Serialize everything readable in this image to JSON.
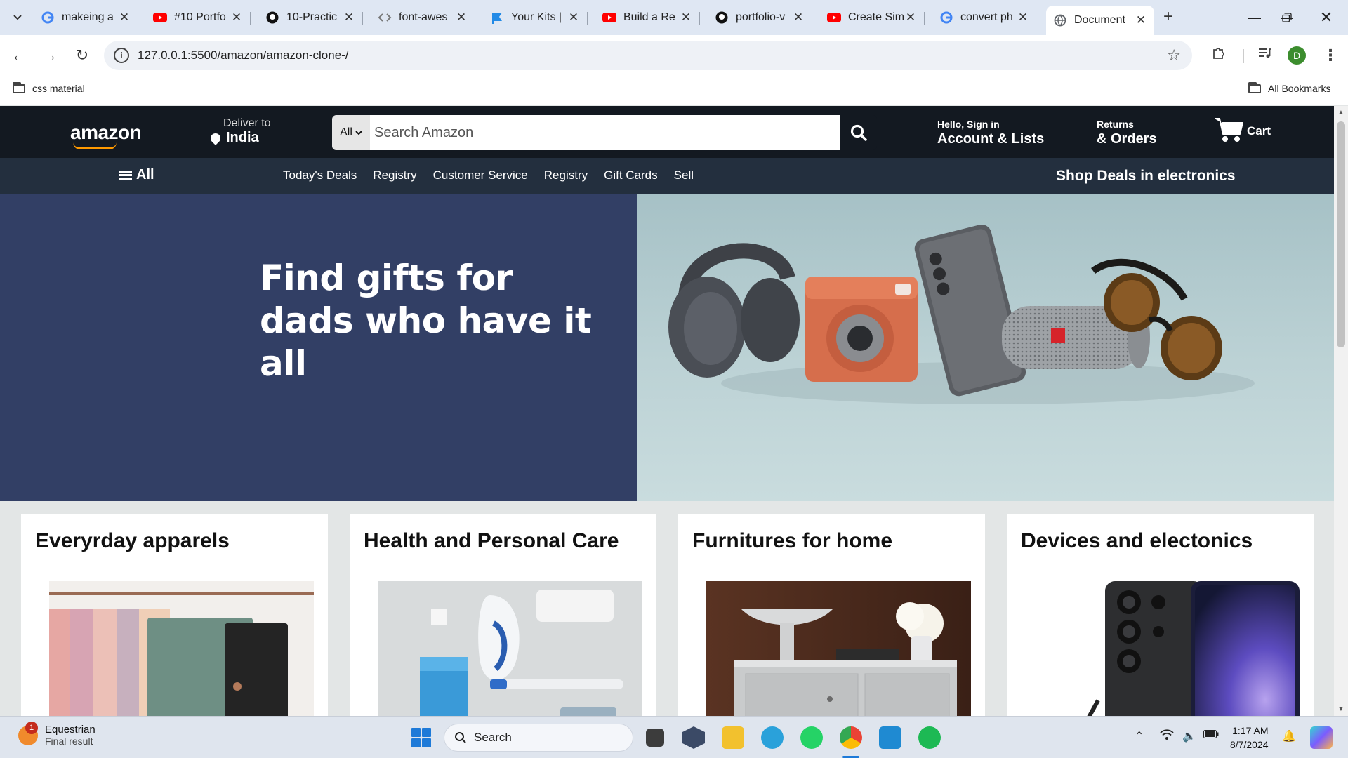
{
  "browser": {
    "tabs": [
      {
        "title": "makeing a",
        "favicon": "google-icon",
        "color": "#4285f4"
      },
      {
        "title": "#10 Portfo",
        "favicon": "youtube-icon",
        "color": "#ff0000"
      },
      {
        "title": "10-Practic",
        "favicon": "github-icon",
        "color": "#111111"
      },
      {
        "title": "font-awes",
        "favicon": "code-icon",
        "color": "#777777"
      },
      {
        "title": "Your Kits |",
        "favicon": "flag-icon",
        "color": "#228ae6"
      },
      {
        "title": "Build a Re",
        "favicon": "youtube-icon",
        "color": "#ff0000"
      },
      {
        "title": "portfolio-v",
        "favicon": "github-icon",
        "color": "#111111"
      },
      {
        "title": "Create Sim",
        "favicon": "youtube-icon",
        "color": "#ff0000"
      },
      {
        "title": "convert ph",
        "favicon": "google-icon",
        "color": "#4285f4"
      },
      {
        "title": "Document",
        "favicon": "globe-icon",
        "color": "#5f6368"
      }
    ],
    "url": "127.0.0.1:5500/amazon/amazon-clone-/",
    "profile_initial": "D",
    "bookmarks": {
      "left": "css material",
      "right": "All Bookmarks"
    }
  },
  "amazon": {
    "logo": "amazon",
    "deliver": {
      "line1": "Deliver to",
      "line2": "India"
    },
    "search": {
      "category": "All",
      "placeholder": "Search Amazon"
    },
    "account": {
      "line1": "Hello, Sign in",
      "line2": "Account & Lists"
    },
    "returns": {
      "line1": "Returns",
      "line2": "& Orders"
    },
    "cart": "Cart",
    "subnav": {
      "all": "All",
      "links": [
        "Today's Deals",
        "Registry",
        "Customer Service",
        "Registry",
        "Gift Cards",
        "Sell"
      ],
      "promo": "Shop Deals in electronics"
    },
    "hero": {
      "line1": "Find gifts for",
      "line2": "dads who have it all"
    },
    "cards": [
      {
        "title": "Everyrday apparels"
      },
      {
        "title": "Health and Personal Care"
      },
      {
        "title": "Furnitures for home"
      },
      {
        "title": "Devices and electonics"
      }
    ],
    "colors": {
      "nav": "#131921",
      "subnav": "#232f3e",
      "hero": "#323f65",
      "accent": "#ff9900"
    }
  },
  "taskbar": {
    "weather": {
      "title": "Equestrian",
      "subtitle": "Final result",
      "badge": "1"
    },
    "search_placeholder": "Search",
    "time": "1:17 AM",
    "date": "8/7/2024"
  }
}
